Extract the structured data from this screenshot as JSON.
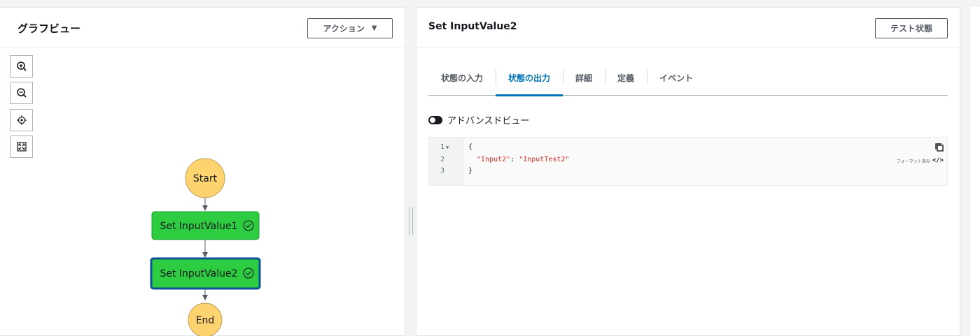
{
  "graph_panel": {
    "title": "グラフビュー",
    "action_button": "アクション",
    "zoom_controls": [
      "zoom-in-icon",
      "zoom-out-icon",
      "center-icon",
      "fit-icon"
    ],
    "nodes": [
      {
        "label": "Start",
        "kind": "terminal"
      },
      {
        "label": "Set InputValue1",
        "kind": "task"
      },
      {
        "label": "Set InputValue2",
        "kind": "task",
        "selected": true
      },
      {
        "label": "End",
        "kind": "terminal"
      }
    ],
    "colors": {
      "terminal": "#fcd36e",
      "task": "#2ecc40",
      "selected_border": "#0b5394"
    }
  },
  "detail_panel": {
    "title": "Set InputValue2",
    "test_state_button": "テスト状態",
    "tabs": [
      {
        "label": "状態の入力",
        "active": false
      },
      {
        "label": "状態の出力",
        "active": true
      },
      {
        "label": "詳細",
        "active": false
      },
      {
        "label": "定義",
        "active": false
      },
      {
        "label": "イベント",
        "active": false
      }
    ],
    "advanced_view_label": "アドバンスドビュー",
    "code": {
      "line_numbers": [
        "1",
        "2",
        "3"
      ],
      "line1": "{",
      "line2_key": "\"Input2\"",
      "line2_sep": ": ",
      "line2_value": "\"InputTest2\"",
      "line3": "}",
      "format_label": "フォーマット済み"
    }
  }
}
